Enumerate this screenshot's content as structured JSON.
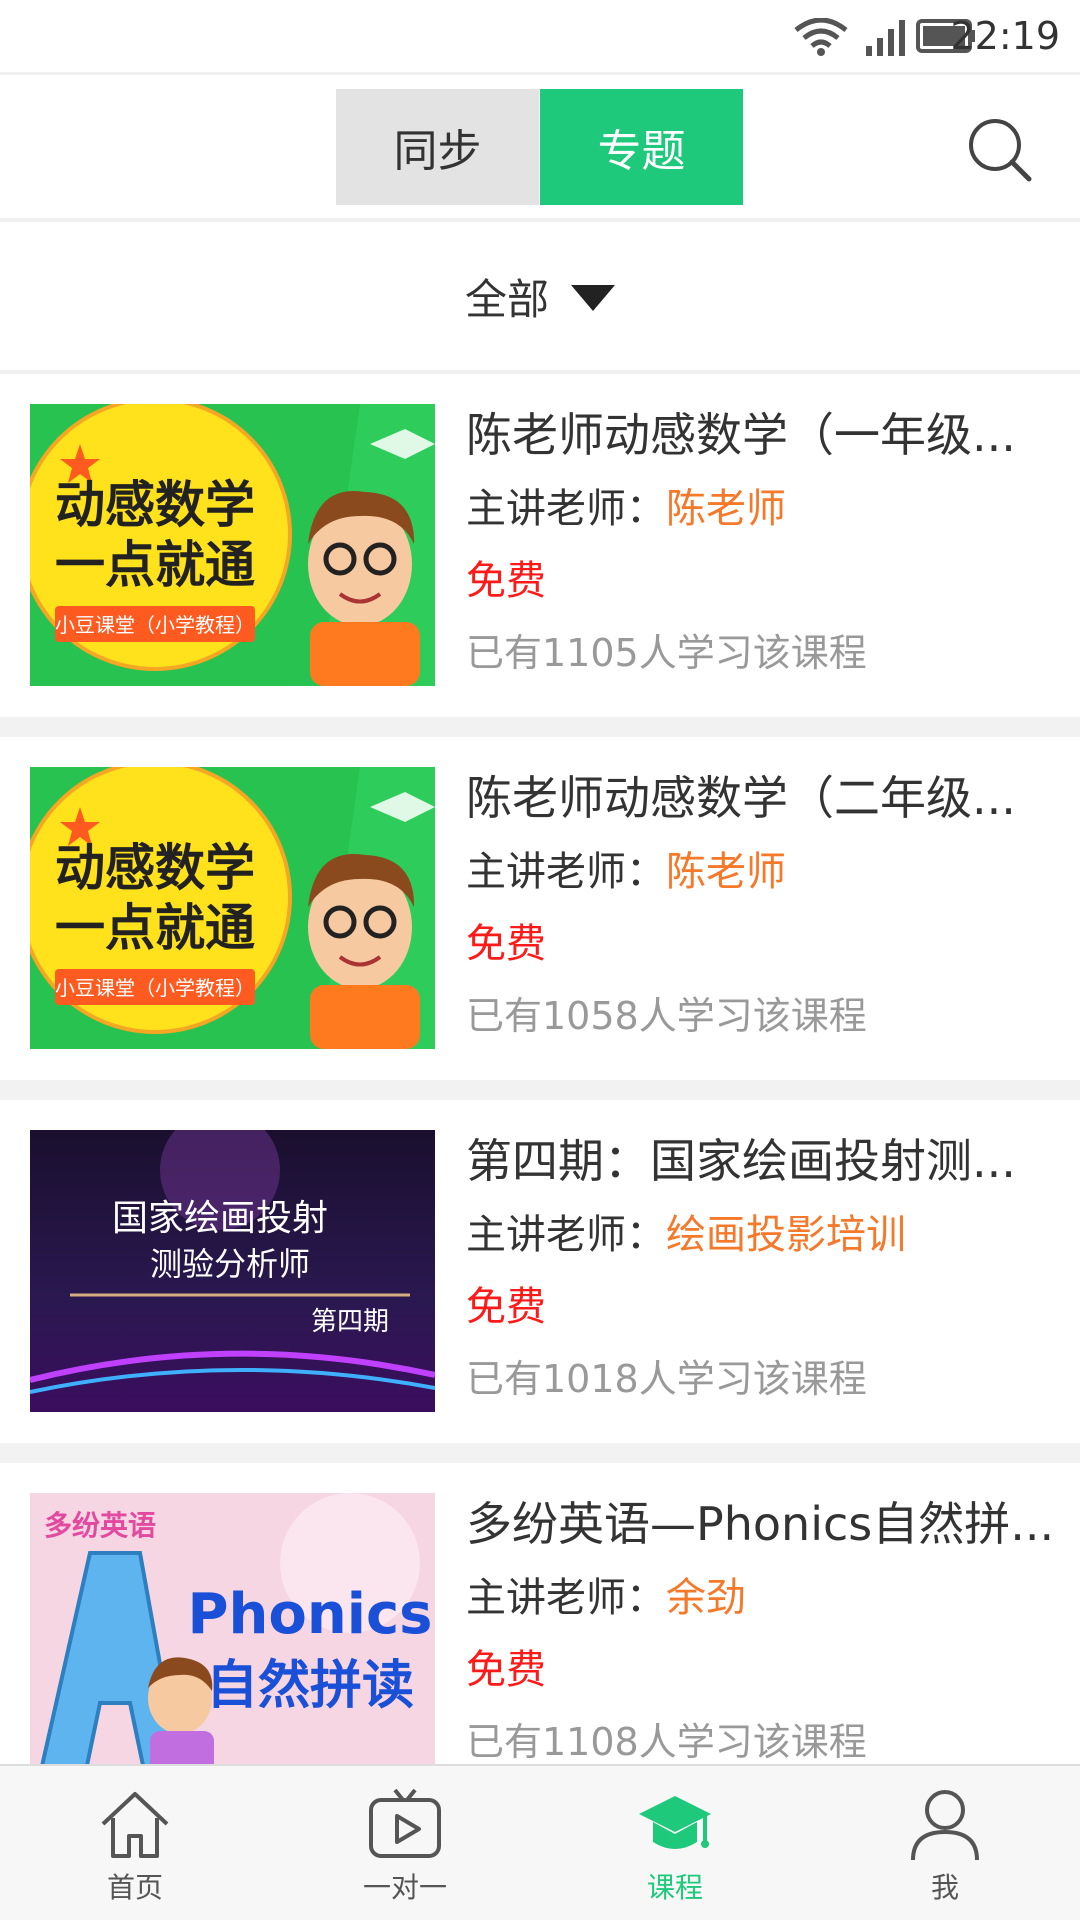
{
  "status_bar": {
    "time": "22:19",
    "icons": [
      "wifi-icon",
      "signal-icon",
      "battery-icon"
    ]
  },
  "header": {
    "segments": [
      {
        "label": "同步",
        "active": false
      },
      {
        "label": "专题",
        "active": true
      }
    ],
    "search_icon": "search-icon"
  },
  "filter": {
    "selected": "全部",
    "icon": "caret-down-icon"
  },
  "colors": {
    "accent_green": "#1ec97b",
    "teacher_orange": "#f5792a",
    "price_red": "#ff1a1a",
    "muted_gray": "#999999"
  },
  "courses": [
    {
      "title": "陈老师动感数学（一年级...",
      "teacher_prefix": "主讲老师：",
      "teacher": "陈老师",
      "price": "免费",
      "learners": "已有1105人学习该课程",
      "thumb": {
        "line1": "动感数学",
        "line2": "一点就通",
        "tag": "小豆课堂（小学教程）"
      }
    },
    {
      "title": "陈老师动感数学（二年级...",
      "teacher_prefix": "主讲老师：",
      "teacher": "陈老师",
      "price": "免费",
      "learners": "已有1058人学习该课程",
      "thumb": {
        "line1": "动感数学",
        "line2": "一点就通",
        "tag": "小豆课堂（小学教程）"
      }
    },
    {
      "title": "第四期：国家绘画投射测...",
      "teacher_prefix": "主讲老师：",
      "teacher": "绘画投影培训",
      "price": "免费",
      "learners": "已有1018人学习该课程",
      "thumb": {
        "line1": "国家绘画投射",
        "line2": "测验分析师",
        "tag": "第四期"
      }
    },
    {
      "title": "多纷英语—Phonics自然拼...",
      "teacher_prefix": "主讲老师：",
      "teacher": "余劲",
      "price": "免费",
      "learners": "已有1108人学习该课程",
      "thumb": {
        "line1": "Phonics",
        "line2": "自然拼读",
        "tag": "多纷英语"
      }
    }
  ],
  "tabbar": {
    "tabs": [
      {
        "label": "首页",
        "icon": "home-icon",
        "active": false
      },
      {
        "label": "一对一",
        "icon": "tv-play-icon",
        "active": false
      },
      {
        "label": "课程",
        "icon": "graduation-cap-icon",
        "active": true
      },
      {
        "label": "我",
        "icon": "person-icon",
        "active": false
      }
    ]
  }
}
